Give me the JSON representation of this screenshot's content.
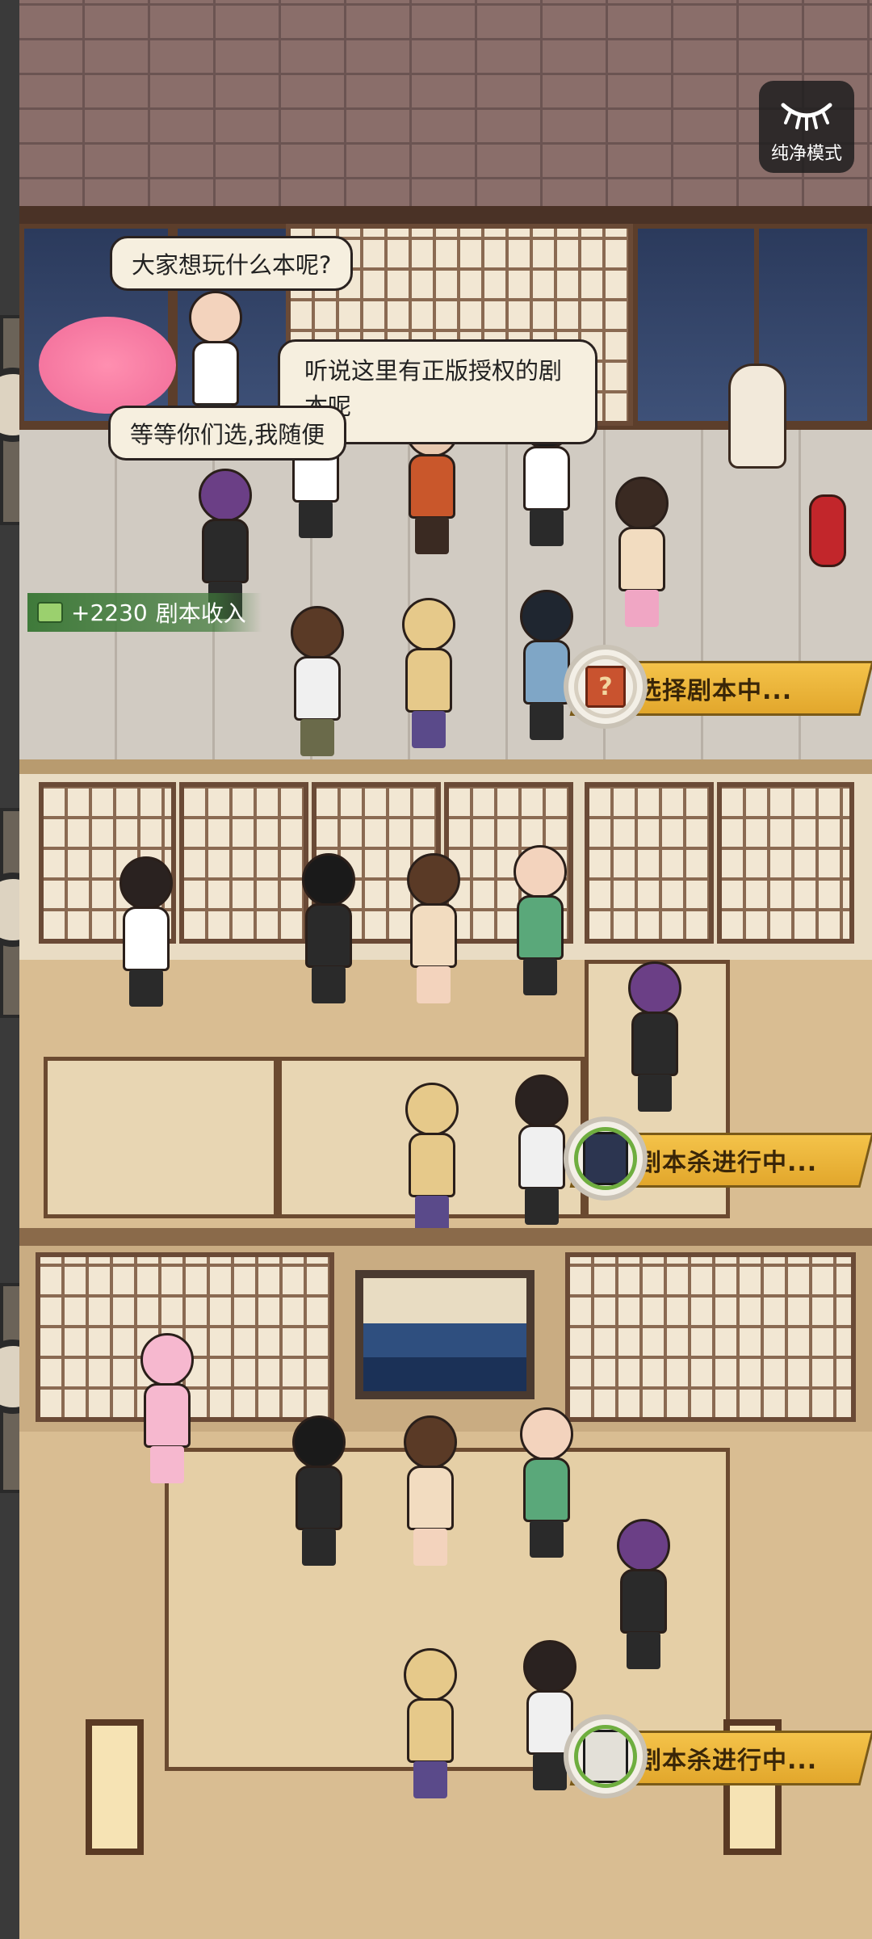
{
  "game": {
    "pure_mode_label": "纯净模式",
    "bubbles": [
      "大家想玩什么本呢?",
      "听说这里有正版授权的剧本呢",
      "等等你们选,我随便"
    ],
    "income": {
      "amount": "+2230",
      "label": "剧本收入"
    },
    "rooms": [
      {
        "status": "选择剧本中...",
        "badge_icon": "question-book-icon",
        "badge_glyph": "?"
      },
      {
        "status": "剧本杀进行中...",
        "badge_icon": "script-poster-icon"
      },
      {
        "status": "剧本杀进行中...",
        "badge_icon": "script-poster-icon"
      }
    ]
  },
  "colors": {
    "banner": "#f4c34a",
    "income_bg": "#3f7a3a",
    "badge_ring": "#6fae3f"
  }
}
